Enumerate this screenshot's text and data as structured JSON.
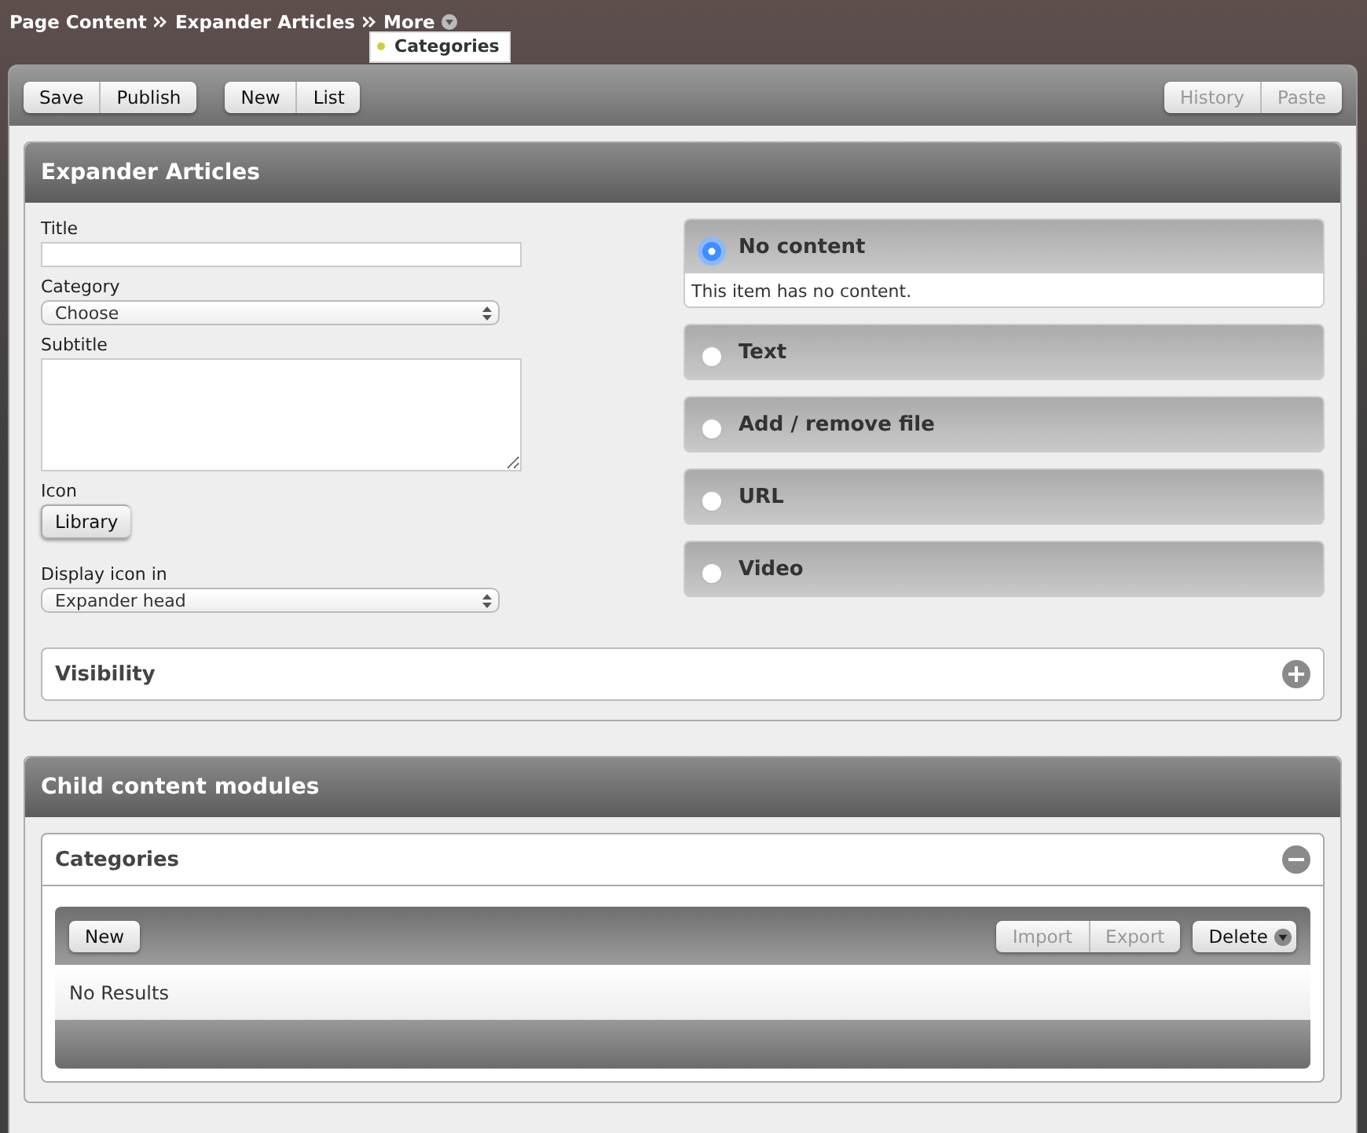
{
  "breadcrumb": [
    {
      "label": "Page Content"
    },
    {
      "label": "Expander Articles"
    },
    {
      "label": "More"
    }
  ],
  "more_menu": [
    {
      "label": "Categories"
    }
  ],
  "toolbar": {
    "groups": [
      [
        {
          "label": "Save",
          "disabled": false
        },
        {
          "label": "Publish",
          "disabled": false
        }
      ],
      [
        {
          "label": "New",
          "disabled": false
        },
        {
          "label": "List",
          "disabled": false
        }
      ]
    ],
    "right_group": [
      {
        "label": "History",
        "disabled": true
      },
      {
        "label": "Paste",
        "disabled": true
      }
    ]
  },
  "editor": {
    "title": "Expander Articles",
    "fields": [
      {
        "kind": "text",
        "label": "Title"
      },
      {
        "kind": "select",
        "label": "Category",
        "value": "Choose"
      },
      {
        "kind": "textarea",
        "label": "Subtitle"
      },
      {
        "kind": "button",
        "label": "Icon",
        "button": "Library"
      },
      {
        "kind": "select",
        "label": "Display icon in",
        "value": "Expander head"
      }
    ],
    "content_options": [
      {
        "label": "No content",
        "selected": true,
        "description": "This item has no content."
      },
      {
        "label": "Text",
        "selected": false
      },
      {
        "label": "Add / remove file",
        "selected": false
      },
      {
        "label": "URL",
        "selected": false
      },
      {
        "label": "Video",
        "selected": false
      }
    ],
    "visibility": {
      "label": "Visibility",
      "expanded": false
    }
  },
  "child_modules": {
    "title": "Child content modules",
    "categories": {
      "label": "Categories",
      "expanded": true,
      "buttons": [
        {
          "label": "New",
          "disabled": false
        }
      ],
      "right_buttons": [
        {
          "label": "Import",
          "disabled": true
        },
        {
          "label": "Export",
          "disabled": true
        }
      ],
      "menu_button": {
        "label": "Delete",
        "disabled": false
      },
      "empty": "No Results"
    }
  }
}
